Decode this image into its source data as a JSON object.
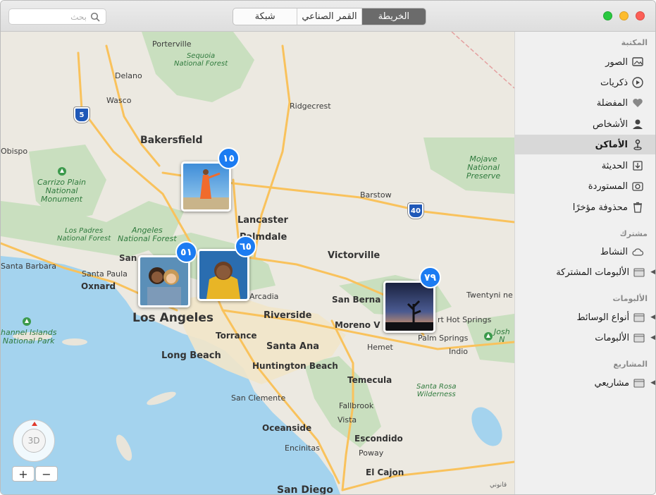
{
  "titlebar": {
    "search_placeholder": "بحث",
    "tabs": [
      {
        "label": "شبكة",
        "active": false
      },
      {
        "label": "القمر الصناعي",
        "active": false
      },
      {
        "label": "الخريطة",
        "active": true
      }
    ],
    "traffic_colors": {
      "close": "#fc5f57",
      "minimize": "#fdbc2e",
      "zoom": "#29c83f"
    }
  },
  "sidebar": {
    "sections": {
      "library": "المكتبة",
      "shared": "مشترك",
      "albums": "الألبومات",
      "projects": "المشاريع"
    },
    "library_items": [
      {
        "label": "الصور",
        "icon": "photos-icon"
      },
      {
        "label": "ذكريات",
        "icon": "memories-icon"
      },
      {
        "label": "المفضلة",
        "icon": "heart-icon"
      },
      {
        "label": "الأشخاص",
        "icon": "person-icon"
      },
      {
        "label": "الأماكن",
        "icon": "places-pin-icon",
        "selected": true
      },
      {
        "label": "الحديثة",
        "icon": "import-icon"
      },
      {
        "label": "المستوردة",
        "icon": "camera-import-icon"
      },
      {
        "label": "محذوفة مؤخرًا",
        "icon": "trash-icon"
      }
    ],
    "shared_items": [
      {
        "label": "النشاط",
        "icon": "cloud-icon"
      },
      {
        "label": "الألبومات المشتركة",
        "icon": "folder-icon"
      }
    ],
    "album_items": [
      {
        "label": "أنواع الوسائط",
        "icon": "folder-icon"
      },
      {
        "label": "الألبومات",
        "icon": "folder-icon"
      }
    ],
    "project_items": [
      {
        "label": "مشاريعي",
        "icon": "folder-icon"
      }
    ]
  },
  "map": {
    "cities": {
      "los_angeles": "Los Angeles",
      "bakersfield": "Bakersfield",
      "lancaster": "Lancaster",
      "palmdale": "Palmdale",
      "victorville": "Victorville",
      "riverside": "Riverside",
      "santa_ana": "Santa Ana",
      "long_beach": "Long Beach",
      "huntington_beach": "Huntington Beach",
      "temecula": "Temecula",
      "oceanside": "Oceanside",
      "escondido": "Escondido",
      "el_cajon": "El Cajon",
      "san_diego": "San Diego",
      "torrance": "Torrance",
      "oxnard": "Oxnard",
      "moreno_valley": "Moreno V",
      "san_bern": "San Berna"
    },
    "towns": {
      "porterville": "Porterville",
      "delano": "Delano",
      "wasco": "Wasco",
      "ridgecrest": "Ridgecrest",
      "obispo": "Obispo",
      "barstow": "Barstow",
      "santa_barbara": "Santa Barbara",
      "santa_paula": "Santa Paula",
      "arcadia": "Arcadia",
      "twentynine": "Twentyni ne",
      "desert_hot": "rt Hot Springs",
      "palm_springs": "Palm Springs",
      "indio": "Indio",
      "hemet": "Hemet",
      "san_clemente": "San Clemente",
      "fallbrook": "Fallbrook",
      "vista": "Vista",
      "encinitas": "Encinitas",
      "poway": "Poway",
      "san_prefix": "San"
    },
    "parks": {
      "sequoia": "Sequoia\nNational Forest",
      "carrizo": "Carrizo Plain\nNational\nMonument",
      "los_padres": "Los Padres\nNational Forest",
      "angeles": "Angeles\nNational Forest",
      "mojave": "Mojave National\nPreserve",
      "channel": "hannel Islands\nNational Park",
      "santa_rosa": "Santa Rosa\nWilderness",
      "joshua": "Josh\nN"
    },
    "shields": {
      "i5": "5",
      "i40": "40"
    },
    "photo_groups": [
      {
        "count": "١٥",
        "photo": "woman-orange-dress"
      },
      {
        "count": "٥١",
        "photo": "two-women-smiling"
      },
      {
        "count": "٦٥",
        "photo": "man-yellow-hoodie"
      },
      {
        "count": "٧٩",
        "photo": "joshua-tree-sunset"
      }
    ],
    "compass_label": "3D",
    "zoom_in": "+",
    "zoom_out": "−",
    "legal": "قانوني"
  },
  "colors": {
    "land": "#ece9e1",
    "water": "#a4d3ee",
    "park": "#c9dfbf",
    "road": "#f9c25c",
    "badge": "#1c7cf2"
  }
}
